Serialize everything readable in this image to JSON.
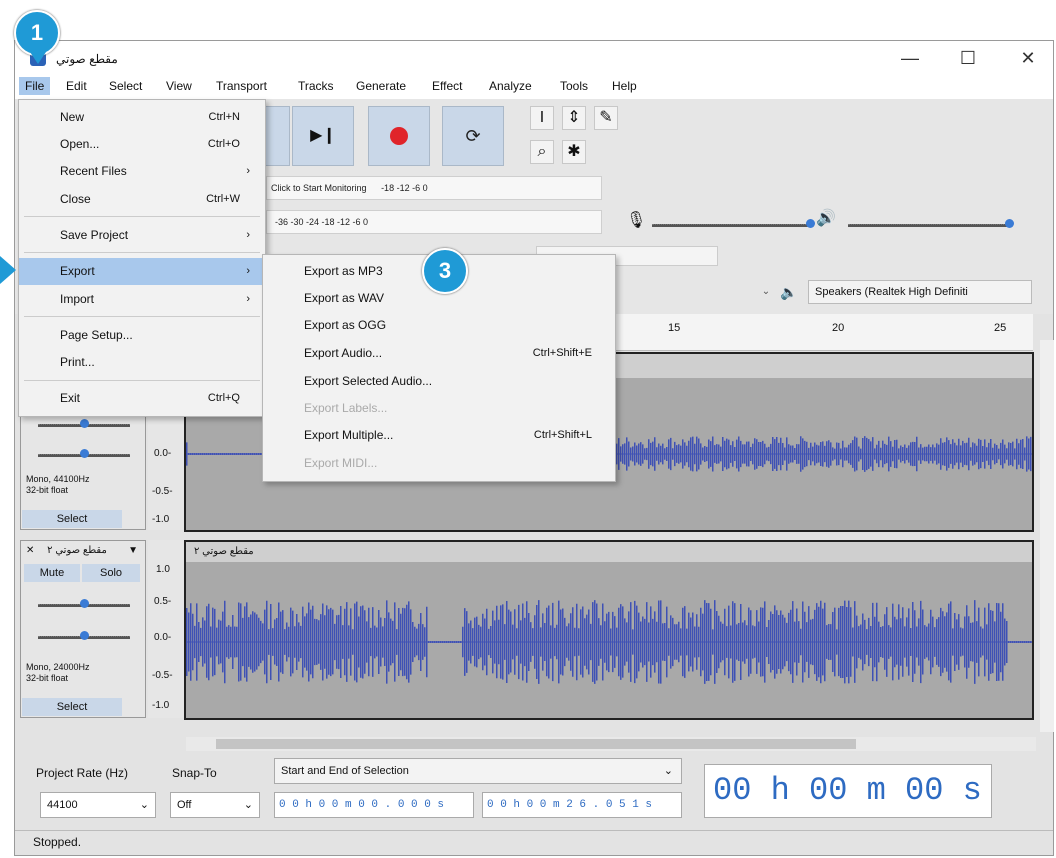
{
  "window": {
    "title": "مقطع صوتي",
    "controls": {
      "minimize": "—",
      "maximize": "☐",
      "close": "✕"
    }
  },
  "menubar": [
    "File",
    "Edit",
    "Select",
    "View",
    "Transport",
    "Tracks",
    "Generate",
    "Effect",
    "Analyze",
    "Tools",
    "Help"
  ],
  "badges": {
    "one": "1",
    "three": "3"
  },
  "file_menu": [
    {
      "label": "New",
      "shortcut": "Ctrl+N"
    },
    {
      "label": "Open...",
      "shortcut": "Ctrl+O"
    },
    {
      "label": "Recent Files",
      "shortcut": "›"
    },
    {
      "label": "Close",
      "shortcut": "Ctrl+W"
    },
    {
      "label": "Save Project",
      "shortcut": "›"
    },
    {
      "label": "Export",
      "shortcut": "›"
    },
    {
      "label": "Import",
      "shortcut": "›"
    },
    {
      "label": "Page Setup...",
      "shortcut": ""
    },
    {
      "label": "Print...",
      "shortcut": ""
    },
    {
      "label": "Exit",
      "shortcut": "Ctrl+Q"
    }
  ],
  "export_menu": [
    {
      "label": "Export as MP3",
      "shortcut": "",
      "disabled": false
    },
    {
      "label": "Export as WAV",
      "shortcut": "",
      "disabled": false
    },
    {
      "label": "Export as OGG",
      "shortcut": "",
      "disabled": false
    },
    {
      "label": "Export Audio...",
      "shortcut": "Ctrl+Shift+E",
      "disabled": false
    },
    {
      "label": "Export Selected Audio...",
      "shortcut": "",
      "disabled": false
    },
    {
      "label": "Export Labels...",
      "shortcut": "",
      "disabled": true
    },
    {
      "label": "Export Multiple...",
      "shortcut": "Ctrl+Shift+L",
      "disabled": false
    },
    {
      "label": "Export MIDI...",
      "shortcut": "",
      "disabled": true
    }
  ],
  "meters": {
    "record_hint": "Click to Start Monitoring",
    "record_scale": "-18   -12    -6     0",
    "play_scale": "-36   -30   -24   -18   -12    -6     0"
  },
  "device": {
    "output": "Speakers (Realtek High Definiti"
  },
  "ruler": [
    "15",
    "20",
    "25"
  ],
  "track1": {
    "info": "Mono, 44100Hz\n32-bit float",
    "select": "Select",
    "scale": [
      "0.0-",
      "-0.5-",
      "-1.0"
    ]
  },
  "track2": {
    "name": "مقطع صوتي ٢",
    "clip": "مقطع صوتي ٢",
    "mute": "Mute",
    "solo": "Solo",
    "info": "Mono, 24000Hz\n32-bit float",
    "select": "Select",
    "scale": [
      "1.0",
      "0.5-",
      "0.0-",
      "-0.5-",
      "-1.0"
    ]
  },
  "bottom": {
    "project_rate_label": "Project Rate (Hz)",
    "snap_label": "Snap-To",
    "project_rate": "44100",
    "snap": "Off",
    "selection_label": "Start and End of Selection",
    "start": "0 0 h 0 0 m 0 0 . 0 0 0 s",
    "end": "0 0 h 0 0 m 2 6 . 0 5 1 s",
    "time": "00 h 00 m 00 s"
  },
  "status": "Stopped.",
  "colors": {
    "accent": "#1f9ad6",
    "wave": "#3f51b5",
    "highlight": "#a8c8ec"
  }
}
